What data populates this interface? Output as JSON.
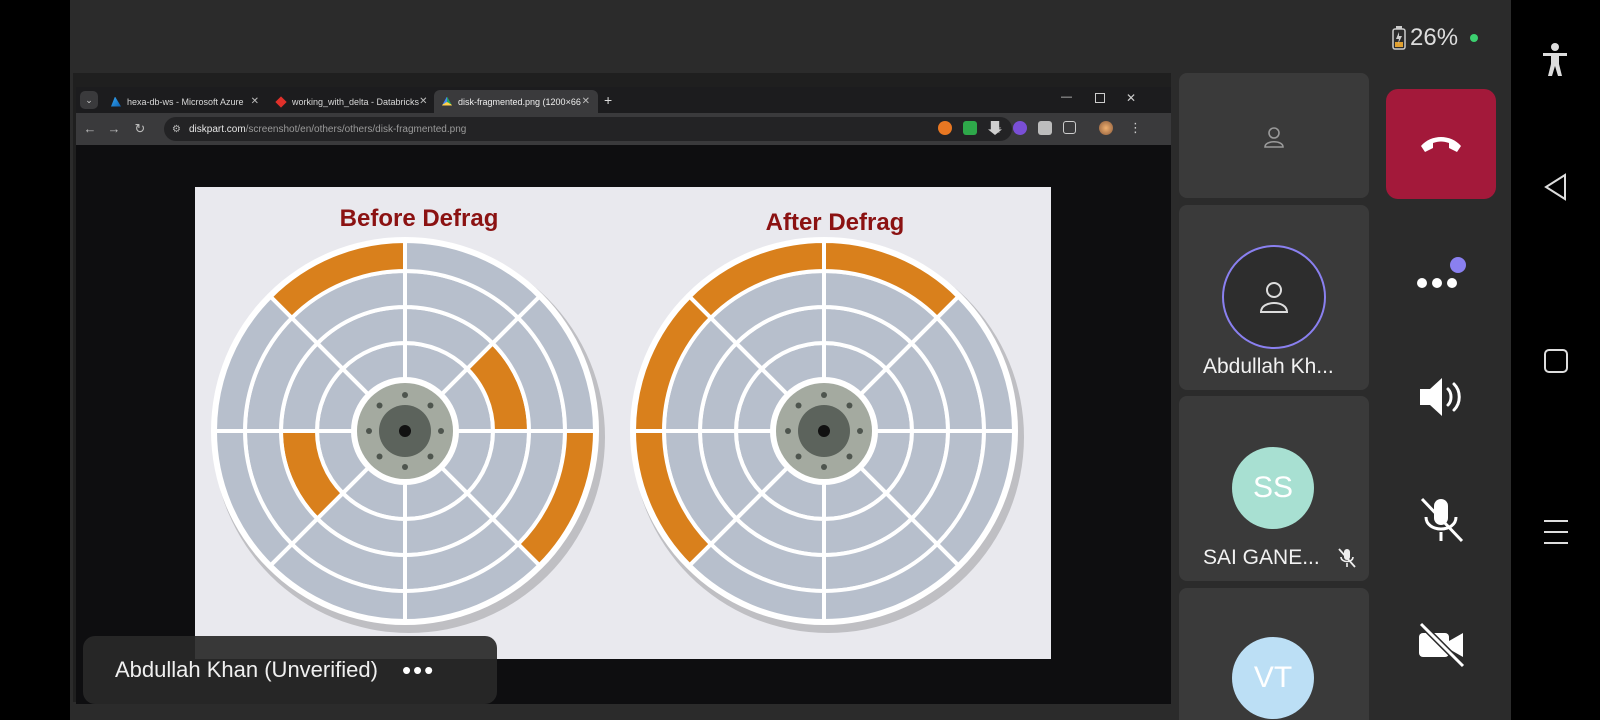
{
  "status": {
    "battery": "26%"
  },
  "browser": {
    "tabs": [
      {
        "label": "hexa-db-ws - Microsoft Azure"
      },
      {
        "label": "working_with_delta - Databricks"
      },
      {
        "label": "disk-fragmented.png (1200×66"
      }
    ],
    "url_domain": "diskpart.com",
    "url_path": "/screenshot/en/others/others/disk-fragmented.png"
  },
  "image": {
    "left_title": "Before Defrag",
    "right_title": "After Defrag"
  },
  "participants": [
    {
      "name": "Abdullah Kh...",
      "initials": ""
    },
    {
      "name": "SAI GANE...",
      "initials": "SS"
    },
    {
      "name": "",
      "initials": "VT"
    }
  ],
  "presenter": {
    "name": "Abdullah Khan (Unverified)"
  },
  "colors": {
    "end_call": "#a3193a",
    "fragment": "#d9801c",
    "sector": "#b7bfcc",
    "title": "#8b1212"
  }
}
